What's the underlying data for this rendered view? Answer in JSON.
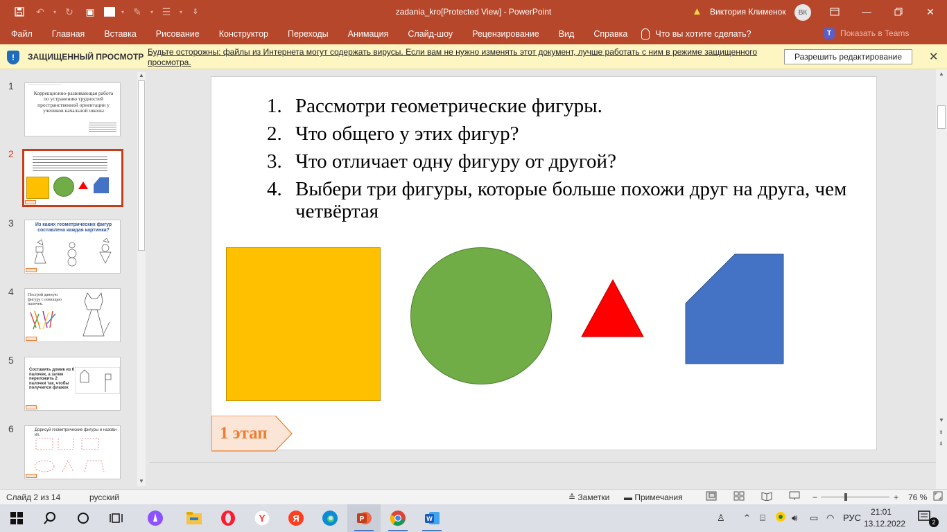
{
  "window": {
    "title": "zadania_kro[Protected View]  -  PowerPoint",
    "user_name": "Виктория Клименок",
    "user_initials": "ВК"
  },
  "ribbon": {
    "tabs": [
      "Файл",
      "Главная",
      "Вставка",
      "Рисование",
      "Конструктор",
      "Переходы",
      "Анимация",
      "Слайд-шоу",
      "Рецензирование",
      "Вид",
      "Справка"
    ],
    "tell_me": "Что вы хотите сделать?",
    "teams": "Показать в Teams"
  },
  "protected_view": {
    "title": "ЗАЩИЩЕННЫЙ ПРОСМОТР",
    "message": "Будьте осторожны: файлы из Интернета могут содержать вирусы. Если вам не нужно изменять этот документ, лучше работать с ним в режиме защищенного просмотра.",
    "enable_button": "Разрешить редактирование"
  },
  "thumbnails": [
    {
      "number": "1",
      "text": "Коррекционно-развивающая работа по устранению трудностей пространственной ориентации у учеников начальной школы"
    },
    {
      "number": "2",
      "text": ""
    },
    {
      "number": "3",
      "text": "Из каких геометрических фигур составлена каждая картинка?"
    },
    {
      "number": "4",
      "text": "Построй данную фигуру с помощью палочек."
    },
    {
      "number": "5",
      "text": "Составить домик из 6 палочек, а затем переложить 2 палочки так, чтобы получился флажок"
    },
    {
      "number": "6",
      "text": "Дорисуй геометрические фигуры и назови их."
    }
  ],
  "slide": {
    "items": [
      {
        "num": "1.",
        "text": "Рассмотри геометрические фигуры."
      },
      {
        "num": "2.",
        "text": "Что общего у этих фигур?"
      },
      {
        "num": "3.",
        "text": "Что отличает одну фигуру от другой?"
      },
      {
        "num": "4.",
        "text": "Выбери три фигуры, которые больше похожи друг на друга, чем четвёртая"
      }
    ],
    "stage_label": "1 этап",
    "colors": {
      "square": "#ffc000",
      "circle": "#70ad47",
      "triangle": "#ff0000",
      "polygon": "#4472c4",
      "stage": "#ed7d31"
    }
  },
  "status": {
    "slide_counter": "Слайд 2 из 14",
    "language": "русский",
    "notes": "Заметки",
    "comments": "Примечания",
    "zoom": "76 %"
  },
  "taskbar": {
    "lang": "РУС",
    "time": "21:01",
    "date": "13.12.2022",
    "notifications": "2"
  }
}
